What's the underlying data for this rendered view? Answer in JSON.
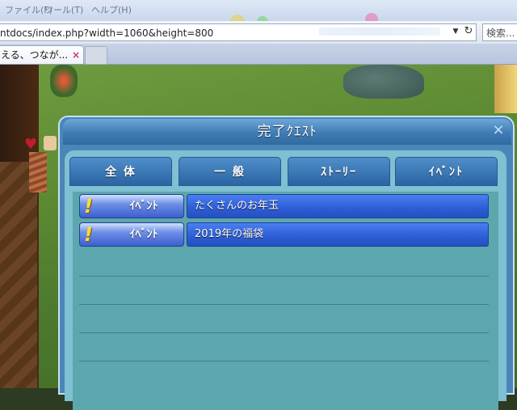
{
  "browser": {
    "menu_items": [
      "ファイル(F)",
      "ツール(T)",
      "ヘルプ(H)"
    ],
    "url": "ntdocs/index.php?width=1060&height=800",
    "reload_icon": "reload-icon",
    "search_placeholder": "検索...",
    "tab_title": "える、つなが...",
    "tab_close": "×"
  },
  "window": {
    "title": "完了ｸｴｽﾄ",
    "close_label": "×",
    "tabs": [
      "全 体",
      "一 般",
      "ｽﾄｰﾘｰ",
      "ｲﾍﾞﾝﾄ"
    ],
    "quests": [
      {
        "category": "ｲﾍﾞﾝﾄ",
        "name": "たくさんのお年玉"
      },
      {
        "category": "ｲﾍﾞﾝﾄ",
        "name": "2019年の福袋"
      }
    ],
    "quest_marker": "!",
    "empty_rows": 4
  },
  "colors": {
    "window_frame": "#4a86b8",
    "panel": "#7fc0d2",
    "list_bg": "#5ca6ad",
    "quest_name_bar": "#2e5fd8",
    "marker": "#ffd93a"
  }
}
